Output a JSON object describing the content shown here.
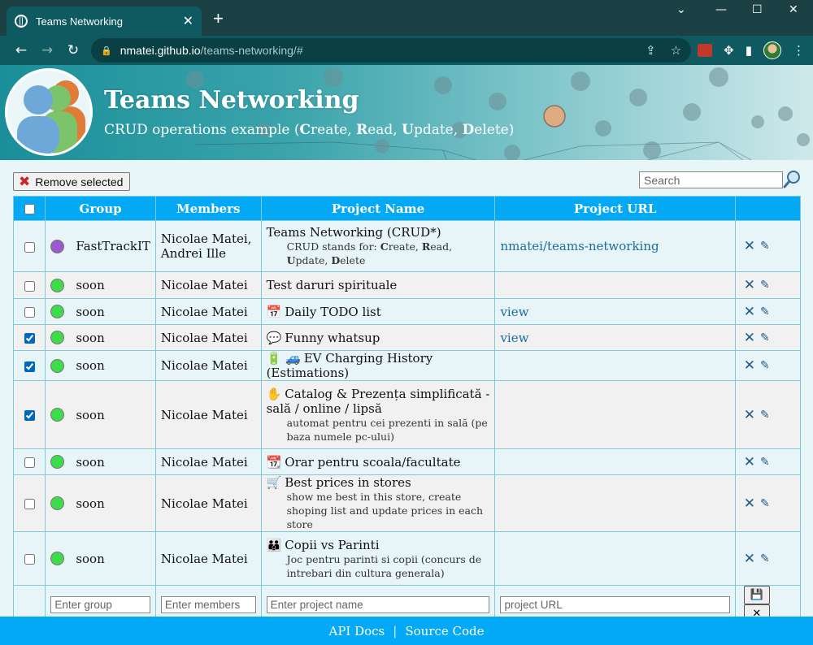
{
  "browser": {
    "tab_title": "Teams Networking",
    "tab_close": "✕",
    "new_tab": "+",
    "url_host": "nmatei.github.io",
    "url_path": "/teams-networking/#"
  },
  "banner": {
    "title": "Teams Networking",
    "subtitle_parts": [
      "CRUD operations example (",
      "C",
      "reate, ",
      "R",
      "ead, ",
      "U",
      "pdate, ",
      "D",
      "elete)"
    ]
  },
  "toolbar": {
    "remove_label": "Remove selected",
    "search_placeholder": "Search"
  },
  "table": {
    "headers": [
      "Group",
      "Members",
      "Project Name",
      "Project URL"
    ],
    "rows": [
      {
        "checked": false,
        "dot_color": "#9b59d0",
        "group": "FastTrackIT",
        "members": "Nicolae Matei, Andrei Ille",
        "icon": "",
        "project": "Teams Networking (CRUD*)",
        "desc": "CRUD stands for: Create, Read, Update, Delete",
        "url": "nmatei/teams-networking"
      },
      {
        "checked": false,
        "dot_color": "#3ddc4a",
        "group": "soon",
        "members": "Nicolae Matei",
        "icon": "",
        "project": "Test daruri spirituale",
        "desc": "",
        "url": ""
      },
      {
        "checked": false,
        "dot_color": "#3ddc4a",
        "group": "soon",
        "members": "Nicolae Matei",
        "icon": "📅",
        "project": "Daily TODO list",
        "desc": "",
        "url": "view"
      },
      {
        "checked": true,
        "dot_color": "#3ddc4a",
        "group": "soon",
        "members": "Nicolae Matei",
        "icon": "💬",
        "project": "Funny whatsup",
        "desc": "",
        "url": "view"
      },
      {
        "checked": true,
        "dot_color": "#3ddc4a",
        "group": "soon",
        "members": "Nicolae Matei",
        "icon": "🔋 🚙",
        "project": "EV Charging History (Estimations)",
        "desc": "",
        "url": ""
      },
      {
        "checked": true,
        "dot_color": "#3ddc4a",
        "group": "soon",
        "members": "Nicolae Matei",
        "icon": "✋",
        "project": "Catalog & Prezența simplificată - sală / online / lipsă",
        "desc": "automat pentru cei prezenti in sală (pe baza numele pc-ului)",
        "url": ""
      },
      {
        "checked": false,
        "dot_color": "#3ddc4a",
        "group": "soon",
        "members": "Nicolae Matei",
        "icon": "📆",
        "project": "Orar pentru scoala/facultate",
        "desc": "",
        "url": ""
      },
      {
        "checked": false,
        "dot_color": "#3ddc4a",
        "group": "soon",
        "members": "Nicolae Matei",
        "icon": "🛒",
        "project": "Best prices in stores",
        "desc": "show me best in this store, create shoping list and update prices in each store",
        "url": ""
      },
      {
        "checked": false,
        "dot_color": "#3ddc4a",
        "group": "soon",
        "members": "Nicolae Matei",
        "icon": "👪",
        "project": "Copii vs Parinti",
        "desc": "Joc pentru parinti si copii (concurs de intrebari din cultura generala)",
        "url": ""
      }
    ],
    "new_row": {
      "group_placeholder": "Enter group",
      "members_placeholder": "Enter members",
      "project_placeholder": "Enter project name",
      "url_placeholder": "project URL",
      "save_icon": "💾",
      "cancel_icon": "✕"
    },
    "delete_icon": "✕",
    "edit_icon": "✎"
  },
  "footer": {
    "api_docs": "API Docs",
    "separator": "|",
    "source_code": "Source Code"
  },
  "colors": {
    "header_bg": "#03a9f4",
    "footer_bg": "#03a9f4",
    "page_bg": "#e8f6f8",
    "action_blue": "#1e5a8a",
    "remove_red": "#c62828"
  }
}
